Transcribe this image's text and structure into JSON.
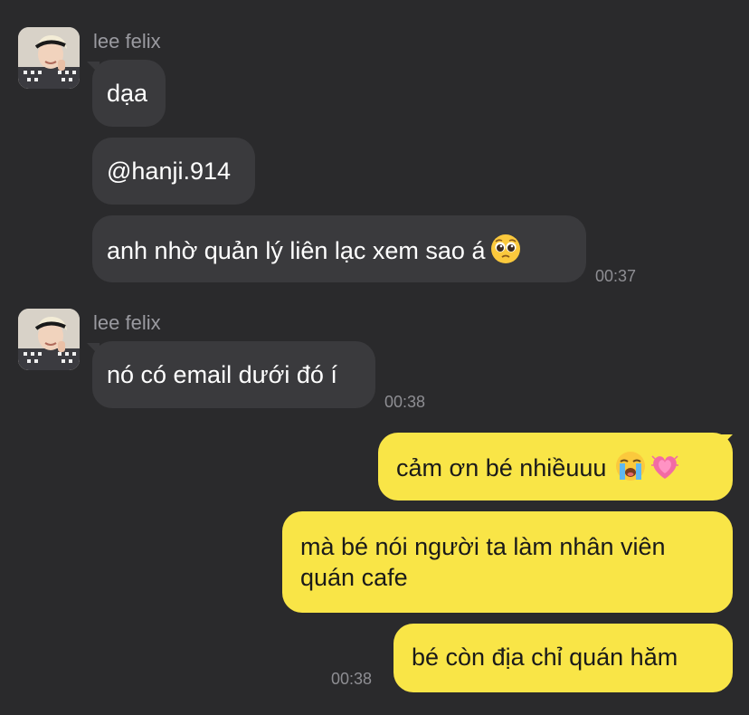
{
  "group1": {
    "sender": "lee felix",
    "messages": [
      {
        "text": "dạa"
      },
      {
        "text": "@hanji.914"
      },
      {
        "text": "anh nhờ quản lý liên lạc xem sao á",
        "emoji": "pleading-face-emoji"
      }
    ],
    "time": "00:37"
  },
  "group2": {
    "sender": "lee felix",
    "messages": [
      {
        "text": "nó có email dưới đó í"
      }
    ],
    "time": "00:38"
  },
  "outgoing": {
    "messages": [
      {
        "text": "cảm ơn bé nhiềuuu",
        "emojis": [
          "loudly-crying-face-emoji",
          "growing-heart-emoji"
        ]
      },
      {
        "line1": "mà bé nói người ta làm nhân viên",
        "line2": "quán cafe"
      },
      {
        "text": "bé còn địa chỉ quán hăm"
      }
    ],
    "time": "00:38"
  },
  "colors": {
    "background": "#2a2a2c",
    "incoming_bubble": "#3a3a3d",
    "outgoing_bubble": "#f9e547",
    "meta_text": "#8e8e93"
  }
}
